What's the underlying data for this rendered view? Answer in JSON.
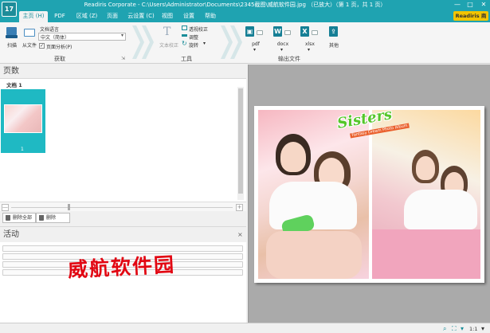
{
  "window": {
    "logo_text": "17",
    "title": "Readiris Corporate - C:\\Users\\Administrator\\Documents\\2345截图\\威航软件园.jpg （已放大）（第 1 页，共 1 页）",
    "minimize": "—",
    "maximize": "□",
    "close": "✕"
  },
  "tabs": [
    {
      "label": "主页 (H)",
      "active": true
    },
    {
      "label": "PDF",
      "active": false
    },
    {
      "label": "区域 (Z)",
      "active": false
    },
    {
      "label": "页面",
      "active": false
    },
    {
      "label": "云设置 (C)",
      "active": false
    },
    {
      "label": "视图",
      "active": false
    },
    {
      "label": "设置",
      "active": false
    },
    {
      "label": "帮助",
      "active": false
    }
  ],
  "store_button": "Readiris 商店",
  "ribbon": {
    "acquire": {
      "group_label": "获取",
      "scan_label": "扫描",
      "from_file_label": "从文件",
      "doc_language_label": "文档语言",
      "language_value": "中文（简体）",
      "page_analysis_label": "页面分析(P)",
      "page_analysis_checked": true
    },
    "tools": {
      "group_label": "工具",
      "text_check_label": "文本校正",
      "perspective_label": "透视校正",
      "adjust_label": "调整",
      "rotate_label": "旋转"
    },
    "output": {
      "group_label": "输出文件",
      "formats": [
        "pdf",
        "docx",
        "xlsx"
      ],
      "other_label": "其他"
    }
  },
  "pages_panel": {
    "title": "页数",
    "document_label": "文档 1",
    "page_number": "1",
    "zoom_minus": "—",
    "zoom_plus": "+",
    "delete_all_label": "删除全部",
    "delete_label": "删除"
  },
  "activity_panel": {
    "title": "活动",
    "close": "×",
    "watermark": "威航软件园"
  },
  "preview": {
    "logo_text": "Sisters",
    "logo_sub": "Fantasy Dream Photo Album"
  },
  "statusbar": {
    "zoom_label": "1:1"
  },
  "colors": {
    "accent": "#1fa3b1",
    "store": "#f2c400",
    "watermark": "#e20612"
  }
}
